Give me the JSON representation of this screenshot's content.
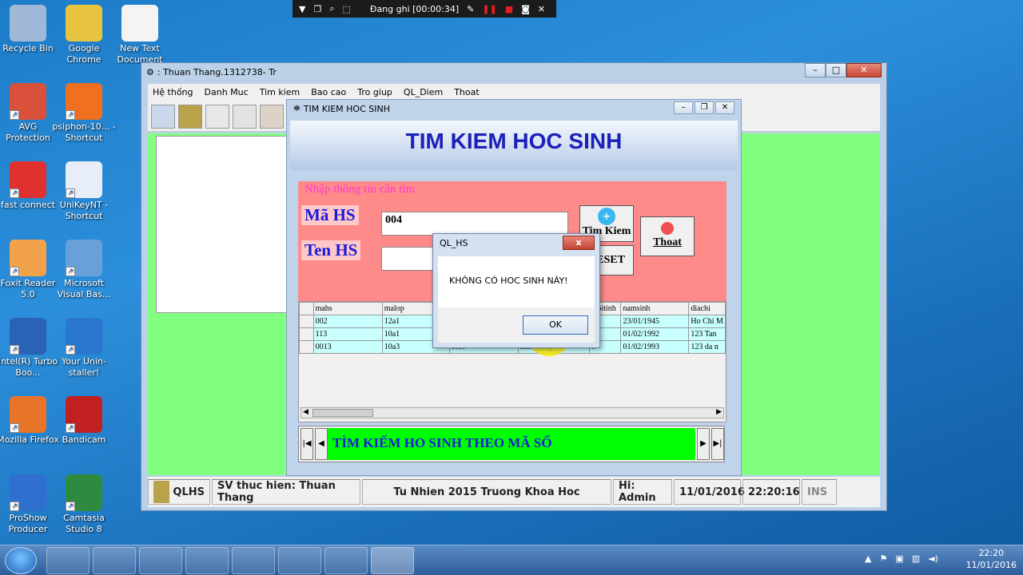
{
  "recorder": {
    "status": "Đang ghi [00:00:34]"
  },
  "desktop": {
    "icons": [
      {
        "label": "Recycle Bin",
        "color": "#9fb8d8"
      },
      {
        "label": "Google Chrome",
        "color": "#e7c340"
      },
      {
        "label": "New Text Document",
        "color": "#f4f4f4"
      },
      {
        "label": "AVG Protection",
        "color": "#d9503b"
      },
      {
        "label": "psiphon-10... - Shortcut",
        "color": "#f07020"
      },
      {
        "label": "fast connect",
        "color": "#e03030"
      },
      {
        "label": "UniKeyNT - Shortcut",
        "color": "#e8eef8"
      },
      {
        "label": "Foxit Reader 5.0",
        "color": "#f2a24a"
      },
      {
        "label": "Microsoft Visual Bas...",
        "color": "#6aa0d8"
      },
      {
        "label": "Intel(R) Turbo Boo...",
        "color": "#2a62b5"
      },
      {
        "label": "Your Unin-staller!",
        "color": "#2b77cf"
      },
      {
        "label": "Mozilla Firefox",
        "color": "#e8742a"
      },
      {
        "label": "Bandicam",
        "color": "#c02020"
      },
      {
        "label": "ProShow Producer",
        "color": "#2e6fd0"
      },
      {
        "label": "Camtasia Studio 8",
        "color": "#2e8a3e"
      }
    ]
  },
  "main_window": {
    "title": ": Thuan Thang.1312738- Tr",
    "menu": [
      "Hệ thống",
      "Danh Muc",
      "Tim kiem",
      "Bao cao",
      "Tro giup",
      "QL_Diem",
      "Thoat"
    ]
  },
  "status_bar": {
    "app": "QLHS",
    "student": "SV thuc hien: Thuan Thang",
    "school": "Tu Nhien 2015 Truong Khoa Hoc",
    "user": "Hi: Admin",
    "date": "11/01/2016",
    "time": "22:20:16",
    "mode": "INS"
  },
  "search_form": {
    "title": "TIM KIEM HOC SINH",
    "banner": "TIM KIEM HOC SINH",
    "group_label": "Nhập thông tin cần tìm",
    "ma_hs_label": "Mã HS",
    "ma_hs_value": "004",
    "ten_hs_label": "Ten HS",
    "ten_hs_value": "",
    "search_button": "Tim Kiem",
    "reset_button": "RESET",
    "exit_button": "Thoat",
    "table": {
      "columns": [
        "mahs",
        "malop",
        "",
        "",
        "gioitinh",
        "namsinh",
        "diachi"
      ],
      "rows": [
        [
          "002",
          "12a1",
          "",
          "",
          "",
          "23/01/1945",
          "Ho Chi M"
        ],
        [
          "113",
          "10a1",
          "",
          "",
          "",
          "01/02/1992",
          "123 Tan"
        ],
        [
          "0013",
          "10a3",
          "K10",
          "linh trung",
          "0",
          "01/02/1993",
          "123 da n"
        ]
      ]
    },
    "nav_text": "TÌM KIẾM HO SINH THEO MÃ SỐ"
  },
  "dialog": {
    "title": "QL_HS",
    "message": "KHÔNG CÓ HOC SINH  NÀY!",
    "ok_label": "OK",
    "close_label": "x"
  },
  "taskbar": {
    "time": "22:20",
    "date": "11/01/2016"
  }
}
